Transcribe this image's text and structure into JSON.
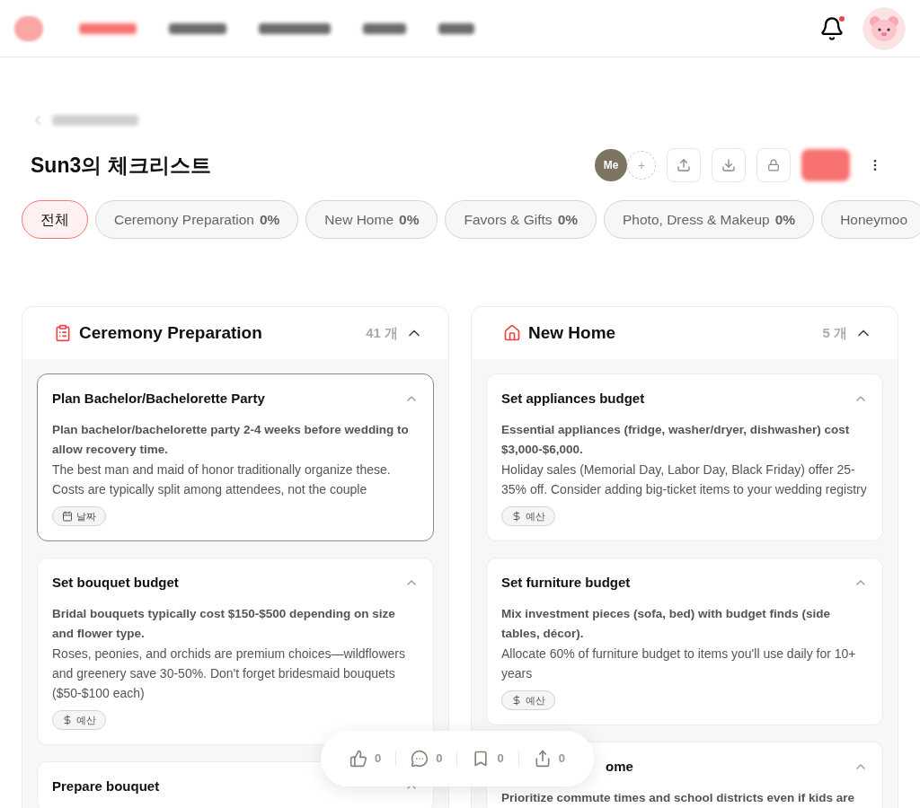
{
  "header": {
    "notifications": {
      "unread": true
    }
  },
  "page": {
    "title": "Sun3의 체크리스트",
    "owner_avatar": "Me",
    "add_member": "+"
  },
  "tabs": [
    {
      "label": "전체",
      "selected": true
    },
    {
      "label": "Ceremony Preparation",
      "percent": "0%",
      "selected": false
    },
    {
      "label": "New Home",
      "percent": "0%",
      "selected": false
    },
    {
      "label": "Favors & Gifts",
      "percent": "0%",
      "selected": false
    },
    {
      "label": "Photo, Dress & Makeup",
      "percent": "0%",
      "selected": false
    },
    {
      "label": "Honeymoo",
      "selected": false
    }
  ],
  "columns": [
    {
      "title": "Ceremony Preparation",
      "kind": "clipboard",
      "count": "41 개",
      "expanded": true,
      "items": [
        {
          "title": "Plan Bachelor/Bachelorette Party",
          "selected": true,
          "expanded": true,
          "summary": "Plan bachelor/bachelorette party 2-4 weeks before wedding to allow recovery time.",
          "detail": "The best man and maid of honor traditionally organize these. Costs are typically split among attendees, not the couple",
          "tag": {
            "kind": "date",
            "label": "날짜"
          }
        },
        {
          "title": "Set bouquet budget",
          "selected": false,
          "expanded": true,
          "summary": "Bridal bouquets typically cost $150-$500 depending on size and flower type.",
          "detail": "Roses, peonies, and orchids are premium choices—wildflowers and greenery save 30-50%. Don't forget bridesmaid bouquets ($50-$100 each)",
          "tag": {
            "kind": "budget",
            "label": "예산"
          }
        },
        {
          "title": "Prepare bouquet",
          "selected": false,
          "expanded": true
        }
      ]
    },
    {
      "title": "New Home",
      "kind": "house",
      "count": "5 개",
      "expanded": true,
      "items": [
        {
          "title": "Set appliances budget",
          "selected": false,
          "expanded": true,
          "summary": "Essential appliances (fridge, washer/dryer, dishwasher) cost $3,000-$6,000.",
          "detail": "Holiday sales (Memorial Day, Labor Day, Black Friday) offer 25-35% off. Consider adding big-ticket items to your wedding registry",
          "tag": {
            "kind": "budget",
            "label": "예산"
          }
        },
        {
          "title": "Set furniture budget",
          "selected": false,
          "expanded": true,
          "summary": "Mix investment pieces (sofa, bed) with budget finds (side tables, décor).",
          "detail": "Allocate 60% of furniture budget to items you'll use daily for 10+ years",
          "tag": {
            "kind": "budget",
            "label": "예산"
          }
        },
        {
          "title": "ome",
          "selected": false,
          "expanded": true,
          "summary": "Prioritize commute times and school districts even if kids are"
        }
      ]
    }
  ],
  "reactions": [
    {
      "kind": "like",
      "count": "0"
    },
    {
      "kind": "comment",
      "count": "0"
    },
    {
      "kind": "bookmark",
      "count": "0"
    },
    {
      "kind": "share",
      "count": "0"
    }
  ]
}
